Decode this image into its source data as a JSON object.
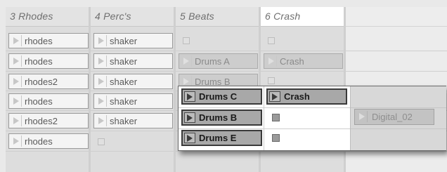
{
  "tracks": [
    {
      "name": "3 Rhodes",
      "slots": [
        {
          "type": "clip",
          "label": "rhodes"
        },
        {
          "type": "clip",
          "label": "rhodes"
        },
        {
          "type": "clip",
          "label": "rhodes2"
        },
        {
          "type": "clip",
          "label": "rhodes"
        },
        {
          "type": "clip",
          "label": "rhodes2"
        },
        {
          "type": "clip",
          "label": "rhodes"
        }
      ]
    },
    {
      "name": "4 Perc's",
      "slots": [
        {
          "type": "clip",
          "label": "shaker"
        },
        {
          "type": "clip",
          "label": "shaker"
        },
        {
          "type": "clip",
          "label": "shaker"
        },
        {
          "type": "clip",
          "label": "shaker"
        },
        {
          "type": "clip",
          "label": "shaker"
        },
        {
          "type": "stop"
        }
      ]
    },
    {
      "name": "5 Beats",
      "slots": [
        {
          "type": "stop"
        },
        {
          "type": "clip-grey",
          "label": "Drums A"
        },
        {
          "type": "clip-grey",
          "label": "Drums B"
        }
      ]
    },
    {
      "name": "6 Crash",
      "slots": [
        {
          "type": "stop"
        },
        {
          "type": "clip-grey",
          "label": "Crash"
        },
        {
          "type": "stop"
        }
      ]
    }
  ],
  "drag_selection": {
    "rows": [
      [
        {
          "type": "clip",
          "label": "Drums C"
        },
        {
          "type": "clip",
          "label": "Crash"
        }
      ],
      [
        {
          "type": "clip",
          "label": "Drums B"
        },
        {
          "type": "stop"
        },
        {
          "type": "clip-grey",
          "label": "Digital_02"
        }
      ],
      [
        {
          "type": "clip",
          "label": "Drums E"
        },
        {
          "type": "stop"
        }
      ]
    ]
  }
}
